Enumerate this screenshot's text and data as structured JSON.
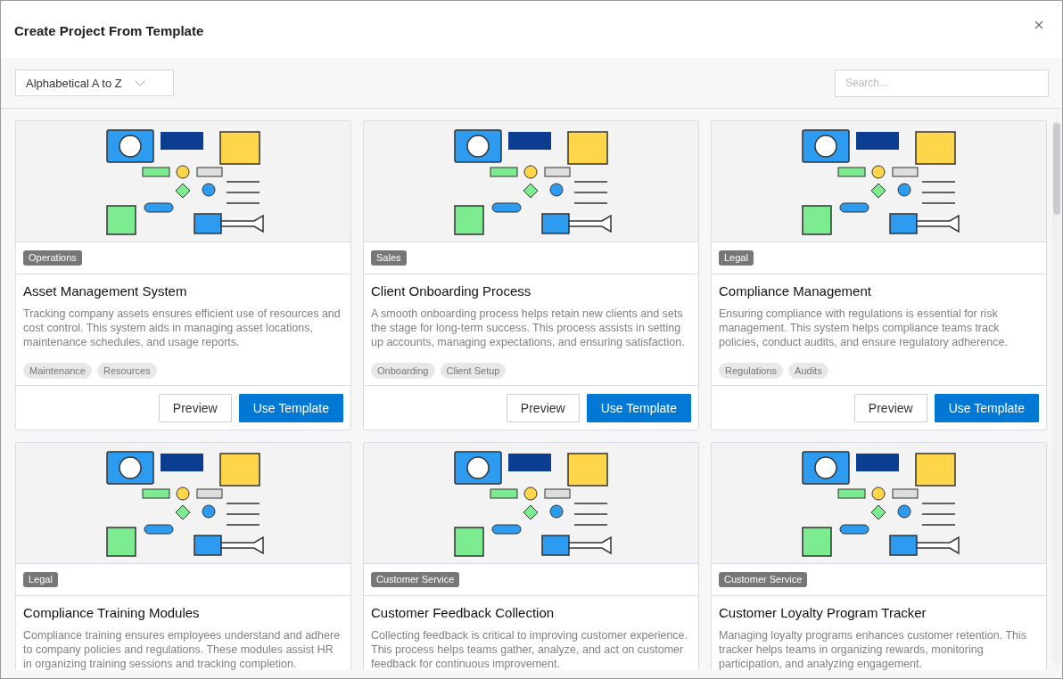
{
  "dialog": {
    "title": "Create Project From Template"
  },
  "toolbar": {
    "sort": "Alphabetical A to Z",
    "search": {
      "placeholder": "Search..."
    }
  },
  "cards": [
    {
      "category": "Operations",
      "title": "Asset Management System",
      "description": "Tracking company assets ensures efficient use of resources and cost control. This system aids in managing asset locations, maintenance schedules, and usage reports.",
      "tags": [
        "Maintenance",
        "Resources"
      ],
      "actions": [
        "Preview",
        "Use Template"
      ]
    },
    {
      "category": "Sales",
      "title": "Client Onboarding Process",
      "description": "A smooth onboarding process helps retain new clients and sets the stage for long-term success. This process assists in setting up accounts, managing expectations, and ensuring satisfaction.",
      "tags": [
        "Onboarding",
        "Client Setup"
      ],
      "actions": [
        "Preview",
        "Use Template"
      ]
    },
    {
      "category": "Legal",
      "title": "Compliance Management",
      "description": "Ensuring compliance with regulations is essential for risk management. This system helps compliance teams track policies, conduct audits, and ensure regulatory adherence.",
      "tags": [
        "Regulations",
        "Audits"
      ],
      "actions": [
        "Preview",
        "Use Template"
      ]
    },
    {
      "category": "Legal",
      "title": "Compliance Training Modules",
      "description": "Compliance training ensures employees understand and adhere to company policies and regulations. These modules assist HR in organizing training sessions and tracking completion."
    },
    {
      "category": "Customer Service",
      "title": "Customer Feedback Collection",
      "description": "Collecting feedback is critical to improving customer experience. This process helps teams gather, analyze, and act on customer feedback for continuous improvement."
    },
    {
      "category": "Customer Service",
      "title": "Customer Loyalty Program Tracker",
      "description": "Managing loyalty programs enhances customer retention. This tracker helps teams in organizing rewards, monitoring participation, and analyzing engagement."
    }
  ]
}
